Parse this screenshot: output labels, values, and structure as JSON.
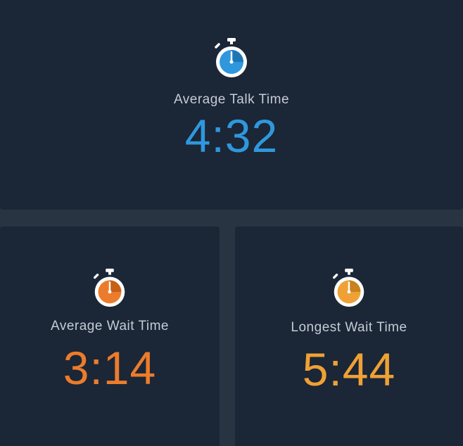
{
  "metrics": {
    "talk": {
      "label": "Average Talk Time",
      "value": "4:32",
      "icon": "stopwatch-icon",
      "color": "#2f97dd"
    },
    "wait": {
      "label": "Average Wait Time",
      "value": "3:14",
      "icon": "stopwatch-icon",
      "color": "#ec7c2b"
    },
    "longest": {
      "label": "Longest Wait Time",
      "value": "5:44",
      "icon": "stopwatch-icon",
      "color": "#efa135"
    }
  }
}
